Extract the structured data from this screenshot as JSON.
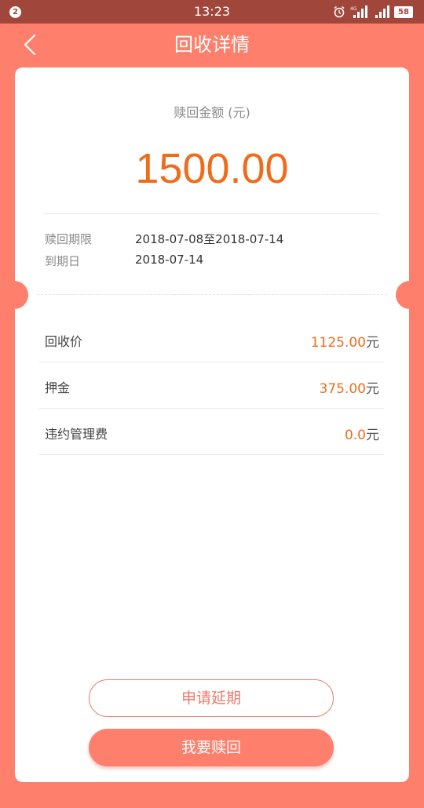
{
  "status_bar": {
    "notification_count": "2",
    "time": "13:23",
    "network_label": "4G",
    "battery": "58"
  },
  "header": {
    "title": "回收详情"
  },
  "summary": {
    "amount_label": "赎回金额 (元)",
    "amount_value": "1500.00"
  },
  "info": [
    {
      "label": "赎回期限",
      "value": "2018-07-08至2018-07-14"
    },
    {
      "label": "到期日",
      "value": "2018-07-14"
    }
  ],
  "fees": [
    {
      "label": "回收价",
      "value": "1125.00",
      "unit": "元"
    },
    {
      "label": "押金",
      "value": "375.00",
      "unit": "元"
    },
    {
      "label": "违约管理费",
      "value": "0.0",
      "unit": "元"
    }
  ],
  "actions": {
    "extend_label": "申请延期",
    "redeem_label": "我要赎回"
  },
  "colors": {
    "primary": "#fd7f6c",
    "status_bar": "#a1463b",
    "accent_text": "#ee6c1b"
  }
}
